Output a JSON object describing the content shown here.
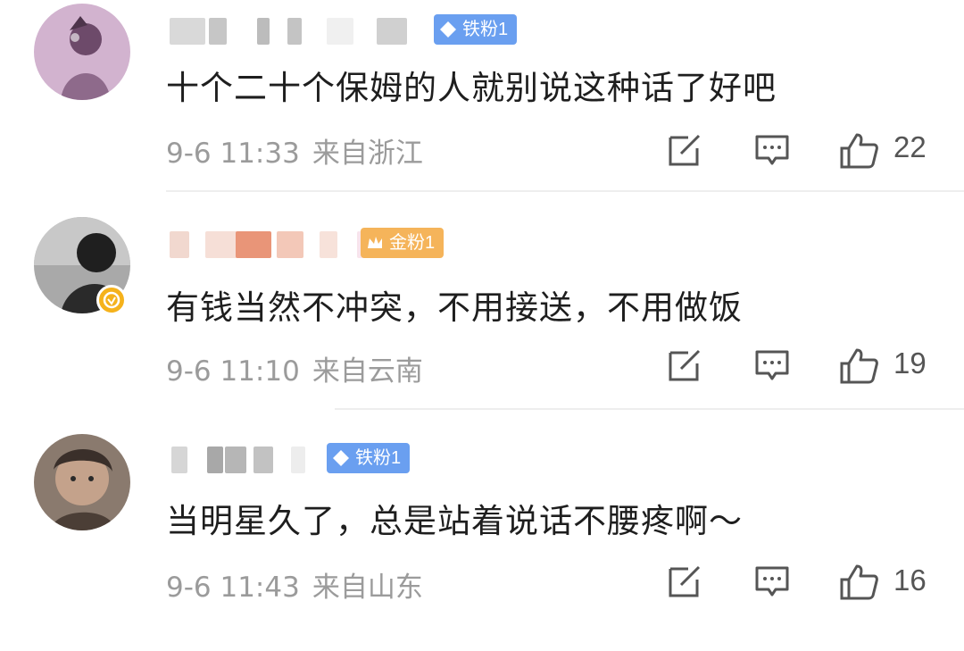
{
  "comments": [
    {
      "badge": "铁粉1",
      "badge_color": "#6a9ff0",
      "content": "十个二十个保姆的人就别说这种话了好吧",
      "time": "9-6 11:33",
      "location": "来自浙江",
      "likes": "22",
      "verified": false,
      "avatar_colors": [
        "#c8a6c4",
        "#6d4a6a"
      ]
    },
    {
      "badge": "金粉1",
      "badge_color": "#f5b45a",
      "content": "有钱当然不冲突，不用接送，不用做饭",
      "time": "9-6 11:10",
      "location": "来自云南",
      "likes": "19",
      "verified": true,
      "avatar_colors": [
        "#9a9a9a",
        "#1f1f1f"
      ]
    },
    {
      "badge": "铁粉1",
      "badge_color": "#6a9ff0",
      "content": "当明星久了，总是站着说话不腰疼啊～",
      "time": "9-6 11:43",
      "location": "来自山东",
      "likes": "16",
      "verified": false,
      "avatar_colors": [
        "#b59a86",
        "#3a2f2a"
      ]
    }
  ],
  "icons": {
    "repost": "repost-icon",
    "comment": "comment-icon",
    "like": "thumbs-up-icon",
    "verified": "verified-badge-icon",
    "diamond": "diamond-icon"
  }
}
